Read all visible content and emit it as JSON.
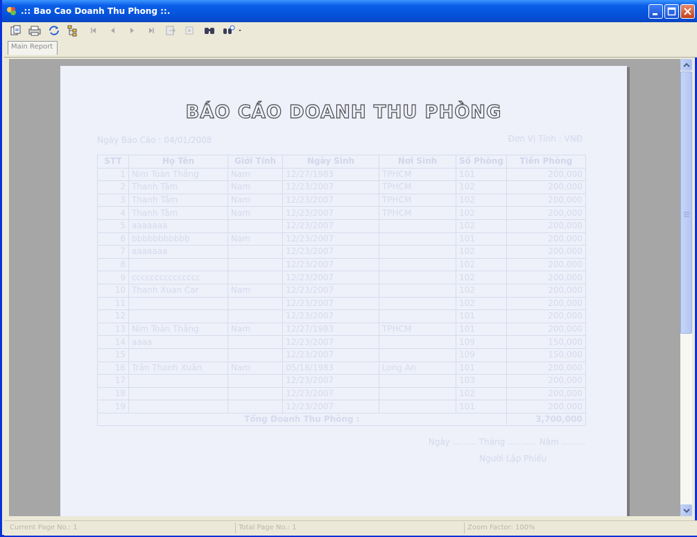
{
  "window": {
    "title": ".:: Bao Cao Doanh Thu Phong ::.",
    "title_bar_color": "#0a5ee8"
  },
  "toolbar": {
    "icons": [
      "export-icon",
      "print-icon",
      "refresh-icon",
      "group-tree-icon",
      "first-page-icon",
      "previous-page-icon",
      "next-page-icon",
      "last-page-icon",
      "goto-page-icon",
      "stop-icon",
      "search-icon",
      "zoom-icon"
    ]
  },
  "tabs": [
    "Main Report"
  ],
  "report": {
    "title": "BÁO CÁO DOANH THU PHÒNG",
    "date_label": "Ngày Báo Cáo :",
    "date_value": "04/01/2008",
    "unit_label": "Đơn Vị Tính : VNĐ",
    "columns": [
      "STT",
      "Họ Tên",
      "Giới Tính",
      "Ngày Sinh",
      "Nơi Sinh",
      "Số Phòng",
      "Tiền Phòng"
    ],
    "rows": [
      [
        "1",
        "Nìm Toàn Thắng",
        "Nam",
        "12/27/1983",
        "TPHCM",
        "101",
        "200,000"
      ],
      [
        "2",
        "Thanh Tâm",
        "Nam",
        "12/23/2007",
        "TPHCM",
        "102",
        "200,000"
      ],
      [
        "3",
        "Thanh Tâm",
        "Nam",
        "12/23/2007",
        "TPHCM",
        "102",
        "200,000"
      ],
      [
        "4",
        "Thanh Tâm",
        "Nam",
        "12/23/2007",
        "TPHCM",
        "102",
        "200,000"
      ],
      [
        "5",
        "aaaaaaa",
        "",
        "12/23/2007",
        "",
        "102",
        "200,000"
      ],
      [
        "6",
        "bbbbbbbbbbb",
        "Nam",
        "12/23/2007",
        "",
        "101",
        "200,000"
      ],
      [
        "7",
        "aaaaaaa",
        "",
        "12/23/2007",
        "",
        "102",
        "200,000"
      ],
      [
        "8",
        "",
        "",
        "12/23/2007",
        "",
        "102",
        "200,000"
      ],
      [
        "9",
        "ccccccccccccccc",
        "",
        "12/23/2007",
        "",
        "102",
        "200,000"
      ],
      [
        "10",
        "Thanh Xuan Car",
        "Nam",
        "12/23/2007",
        "",
        "102",
        "200,000"
      ],
      [
        "11",
        "",
        "",
        "12/23/2007",
        "",
        "102",
        "200,000"
      ],
      [
        "12",
        "",
        "",
        "12/23/2007",
        "",
        "101",
        "200,000"
      ],
      [
        "13",
        "Nìm Toàn Thắng",
        "Nam",
        "12/27/1983",
        "TPHCM",
        "101",
        "200,000"
      ],
      [
        "14",
        "aaaa",
        "",
        "12/23/2007",
        "",
        "109",
        "150,000"
      ],
      [
        "15",
        "",
        "",
        "12/23/2007",
        "",
        "109",
        "150,000"
      ],
      [
        "16",
        "Trần Thanh Xuân",
        "Nam",
        "05/18/1983",
        "Long An",
        "101",
        "200,000"
      ],
      [
        "17",
        "",
        "",
        "12/23/2007",
        "",
        "103",
        "200,000"
      ],
      [
        "18",
        "",
        "",
        "12/23/2007",
        "",
        "102",
        "200,000"
      ],
      [
        "19",
        "",
        "",
        "12/23/2007",
        "",
        "101",
        "200,000"
      ]
    ],
    "total_label": "Tổng Doanh Thu Phòng :",
    "total_value": "3,700,000",
    "footer_date": "Ngày ......... Tháng ........... Năm .........",
    "footer_signer": "Người Lập Phiếu"
  },
  "status": {
    "current_page": "Current Page No.: 1",
    "total_page": "Total Page No.: 1",
    "zoom": "Zoom Factor: 100%"
  }
}
